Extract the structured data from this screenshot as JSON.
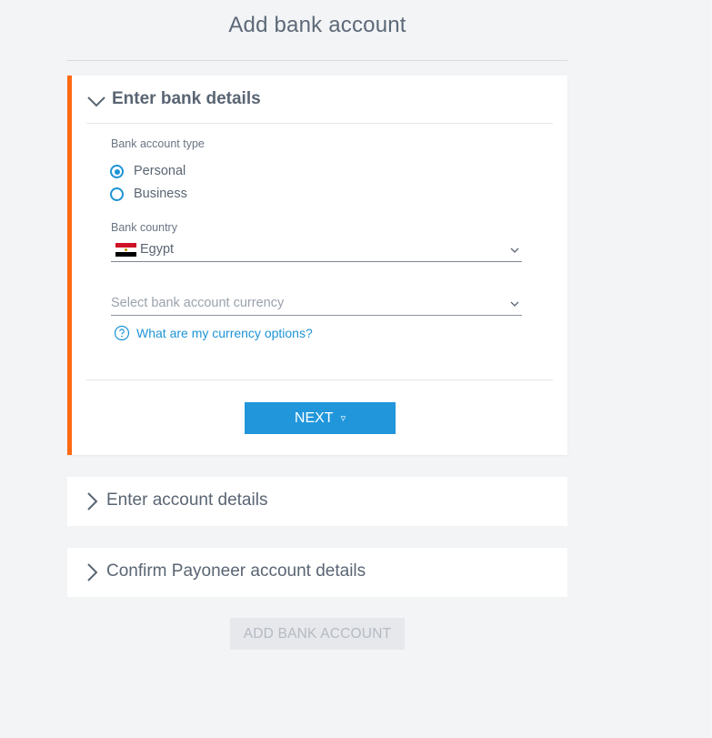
{
  "page": {
    "title": "Add bank account"
  },
  "sections": {
    "bank_details": {
      "title": "Enter bank details",
      "state": "expanded",
      "accent_color": "#ff6a13",
      "account_type_label": "Bank account type",
      "account_types": [
        {
          "label": "Personal",
          "selected": true
        },
        {
          "label": "Business",
          "selected": false
        }
      ],
      "country_label": "Bank country",
      "country_value": "Egypt",
      "country_flag": "egypt-flag",
      "currency_placeholder": "Select bank account currency",
      "help_link": "What are my currency options?",
      "next_label": "NEXT",
      "next_arrow": "▿"
    },
    "account_details": {
      "title": "Enter account details",
      "state": "collapsed"
    },
    "confirm_details": {
      "title": "Confirm Payoneer account details",
      "state": "collapsed"
    }
  },
  "footer": {
    "add_button_label": "ADD BANK ACCOUNT",
    "add_button_disabled": true
  },
  "colors": {
    "primary": "#2196db",
    "accent": "#ff6a13",
    "background": "#f3f4f6",
    "text": "#5a6573"
  }
}
